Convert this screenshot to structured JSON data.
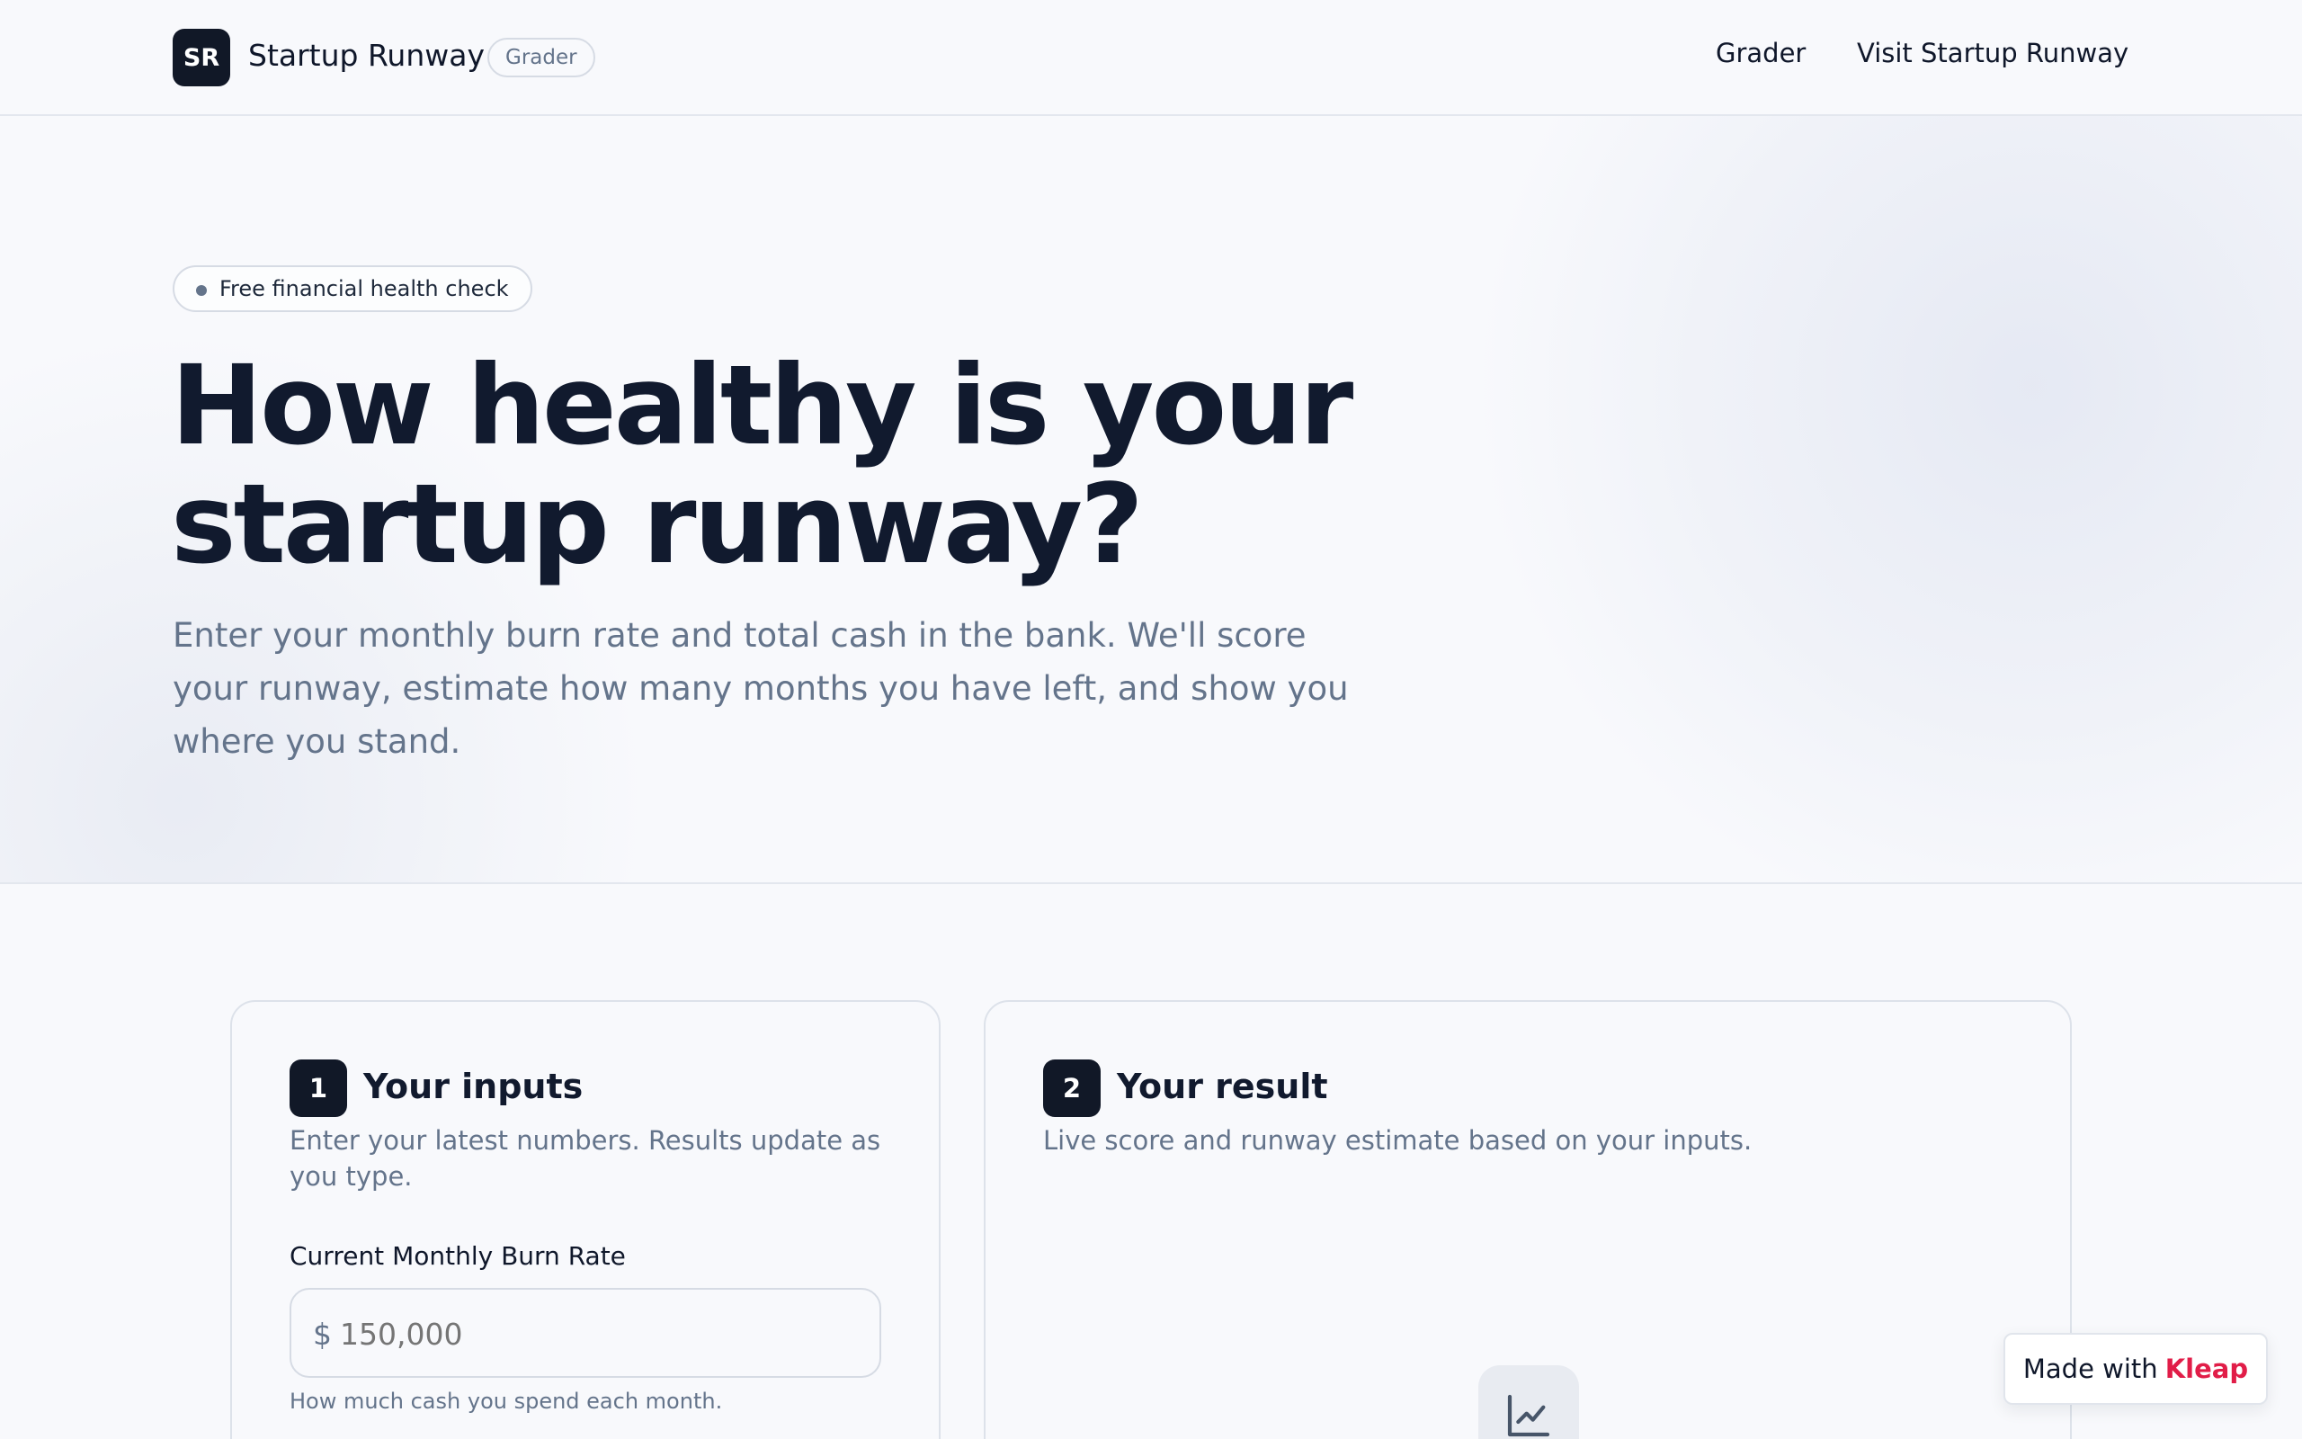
{
  "header": {
    "logo_text": "SR",
    "brand_name": "Startup Runway",
    "badge": "Grader",
    "nav": [
      {
        "label": "Grader"
      },
      {
        "label": "Visit Startup Runway"
      }
    ]
  },
  "hero": {
    "pill": "Free financial health check",
    "title": "How healthy is your startup runway?",
    "subtitle": "Enter your monthly burn rate and total cash in the bank. We'll score your runway, estimate how many months you have left, and show you where you stand."
  },
  "inputs_card": {
    "step": "1",
    "title": "Your inputs",
    "description": "Enter your latest numbers. Results update as you type.",
    "burn_field": {
      "label": "Current Monthly Burn Rate",
      "prefix": "$",
      "placeholder": "150,000",
      "help": "How much cash you spend each month."
    }
  },
  "result_card": {
    "step": "2",
    "title": "Your result",
    "description": "Live score and runway estimate based on your inputs.",
    "icon": "line-chart-icon"
  },
  "made_with": {
    "prefix": "Made with",
    "brand": "Kleap"
  },
  "colors": {
    "primary_dark": "#111827",
    "muted_text": "#64748b",
    "kleap_brand": "#e11d48",
    "background": "#f8f9fc"
  }
}
